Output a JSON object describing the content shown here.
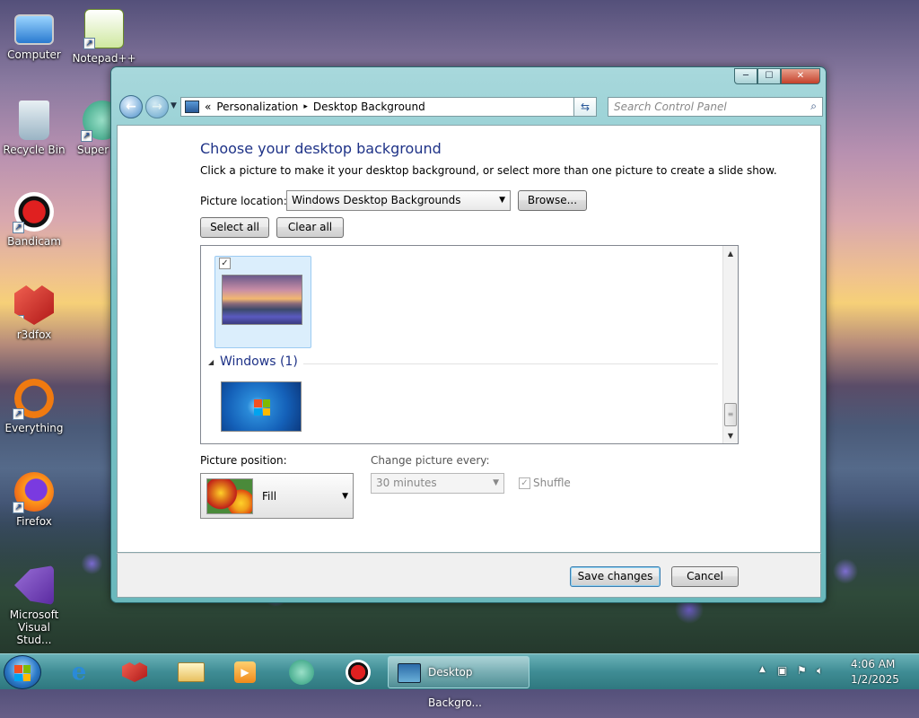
{
  "desktop": {
    "icons": [
      {
        "label": "Computer",
        "icon": "computer-icon"
      },
      {
        "label": "Notepad++",
        "icon": "notepad-plus-plus-icon"
      },
      {
        "label": "Recycle Bin",
        "icon": "recycle-bin-icon"
      },
      {
        "label": "Super",
        "icon": "supermium-icon"
      },
      {
        "label": "Bandicam",
        "icon": "bandicam-icon"
      },
      {
        "label": "r3dfox",
        "icon": "r3dfox-icon"
      },
      {
        "label": "Everything",
        "icon": "everything-icon"
      },
      {
        "label": "Firefox",
        "icon": "firefox-icon"
      },
      {
        "label": "Microsoft Visual Stud...",
        "icon": "visual-studio-icon"
      }
    ]
  },
  "window": {
    "title_controls": {
      "minimize": "─",
      "maximize": "☐",
      "close": "✕"
    },
    "breadcrumb": [
      "«",
      "Personalization",
      "▸",
      "Desktop Background"
    ],
    "search_placeholder": "Search Control Panel",
    "heading": "Choose your desktop background",
    "description": "Click a picture to make it your desktop background, or select more than one picture to create a slide show.",
    "picture_location_label": "Picture location:",
    "picture_location_value": "Windows Desktop Backgrounds",
    "browse_label": "Browse...",
    "select_all_label": "Select all",
    "clear_all_label": "Clear all",
    "group_label": "Windows (1)",
    "picture_position_label": "Picture position:",
    "picture_position_value": "Fill",
    "change_picture_label": "Change picture every:",
    "change_picture_value": "30 minutes",
    "shuffle_label": "Shuffle",
    "save_label": "Save changes",
    "cancel_label": "Cancel"
  },
  "taskbar": {
    "active_task": "Desktop Backgro...",
    "time": "4:06 AM",
    "date": "1/2/2025"
  },
  "colors": {
    "heading": "#1e3287",
    "window_frame": "#7cc4c8",
    "taskbar": "#3f8c94",
    "selected_tile": "#dbeefc"
  }
}
